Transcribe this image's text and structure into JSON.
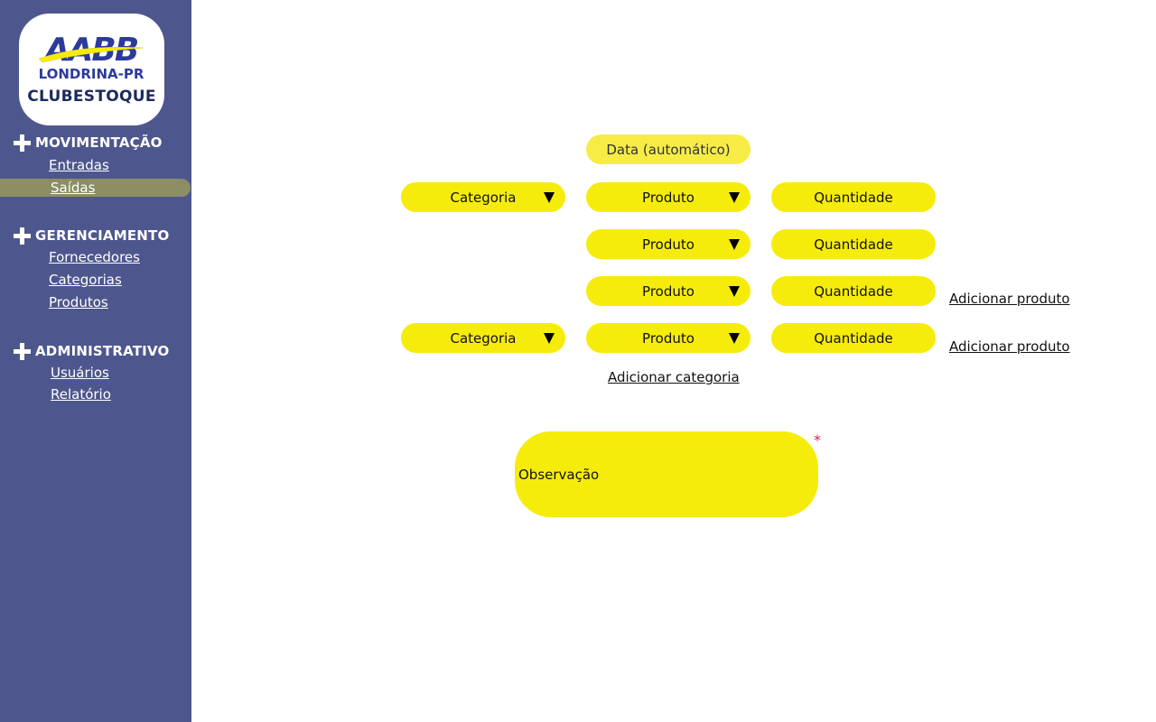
{
  "brand": {
    "logo_text": "AABB",
    "logo_subtitle": "LONDRINA-PR",
    "app_name": "CLUBESTOQUE",
    "colors": {
      "navy": "#1c2a5c",
      "blue": "#2b3b9a",
      "swoosh": "#f6ec0b"
    }
  },
  "sidebar": {
    "background": "#4e578d",
    "sections": [
      {
        "title": "MOVIMENTAÇÃO",
        "icon": "plus-icon",
        "items": [
          {
            "label": "Entradas"
          },
          {
            "label": "Saídas",
            "active": true
          }
        ]
      },
      {
        "title": "GERENCIAMENTO",
        "icon": "plus-icon",
        "items": [
          {
            "label": "Fornecedores"
          },
          {
            "label": "Categorias"
          },
          {
            "label": "Produtos"
          }
        ]
      },
      {
        "title": "ADMINISTRATIVO",
        "icon": "plus-icon",
        "items": [
          {
            "label": "Usuários"
          },
          {
            "label": "Relatório"
          }
        ]
      }
    ]
  },
  "form": {
    "date_label": "Data (automático)",
    "category_label": "Categoria",
    "product_label": "Produto",
    "quantity_label": "Quantidade",
    "add_product_label": "Adicionar produto",
    "add_category_label": "Adicionar categoria",
    "observation_label": "Observação",
    "required_mark": "*",
    "field_color": "#f6ec0b",
    "dropdown_icon": "triangle-down-icon"
  }
}
